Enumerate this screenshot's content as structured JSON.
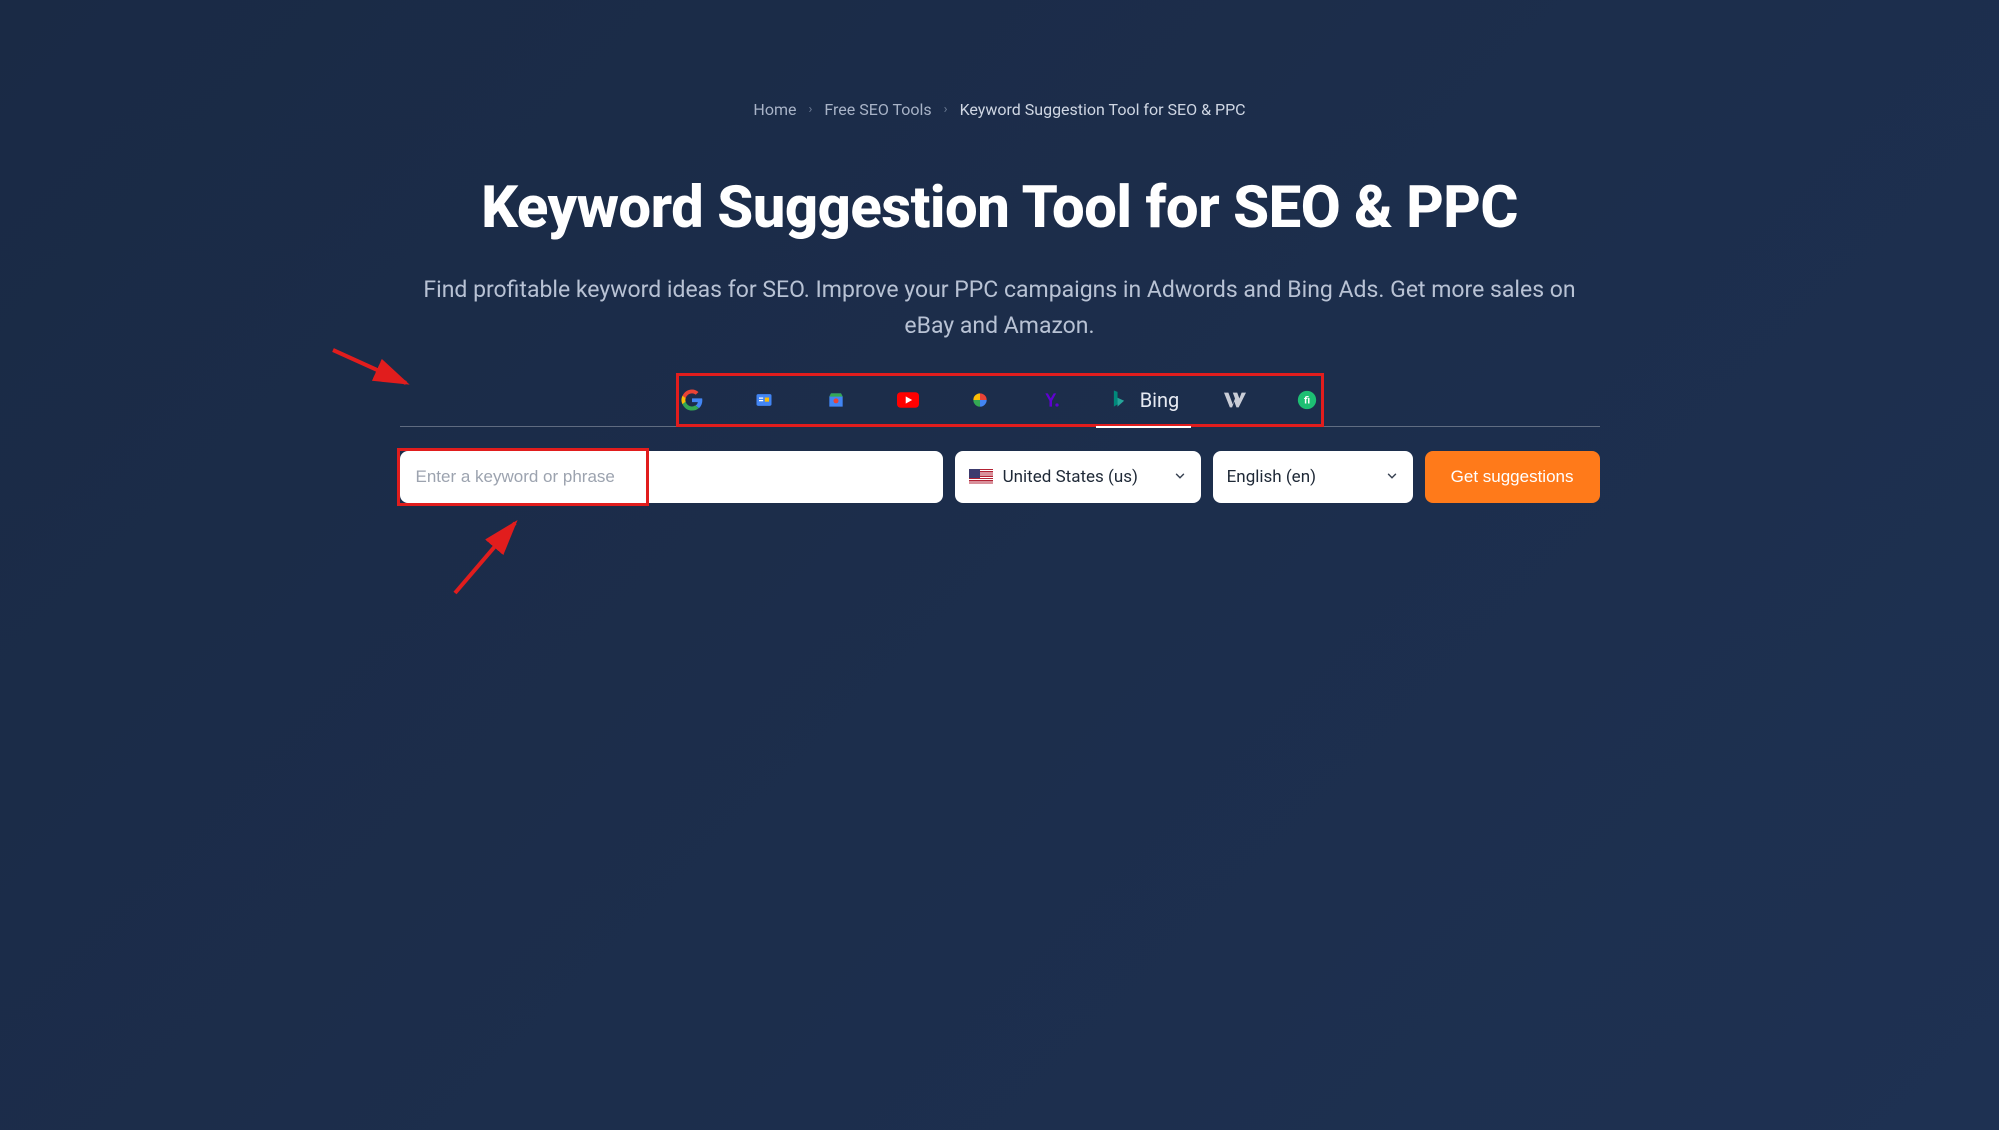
{
  "breadcrumb": {
    "home": "Home",
    "tools": "Free SEO Tools",
    "current": "Keyword Suggestion Tool for SEO & PPC"
  },
  "title": "Keyword Suggestion Tool for SEO & PPC",
  "subtitle": "Find profitable keyword ideas for SEO. Improve your PPC campaigns in Adwords and Bing Ads. Get more sales on eBay and Amazon.",
  "engines": {
    "items": [
      {
        "name": "google",
        "label": "Google"
      },
      {
        "name": "google-news",
        "label": "Google News"
      },
      {
        "name": "google-shopping",
        "label": "Google Shopping"
      },
      {
        "name": "youtube",
        "label": "YouTube"
      },
      {
        "name": "google-photos",
        "label": "Google Photos"
      },
      {
        "name": "yahoo",
        "label": "Yahoo"
      },
      {
        "name": "bing",
        "label": "Bing",
        "active": true
      },
      {
        "name": "wikipedia",
        "label": "Wikipedia"
      },
      {
        "name": "fiverr",
        "label": "Fiverr"
      }
    ]
  },
  "search": {
    "placeholder": "Enter a keyword or phrase",
    "value": ""
  },
  "country": {
    "selected": "United States (us)"
  },
  "language": {
    "selected": "English (en)"
  },
  "submit_label": "Get suggestions"
}
